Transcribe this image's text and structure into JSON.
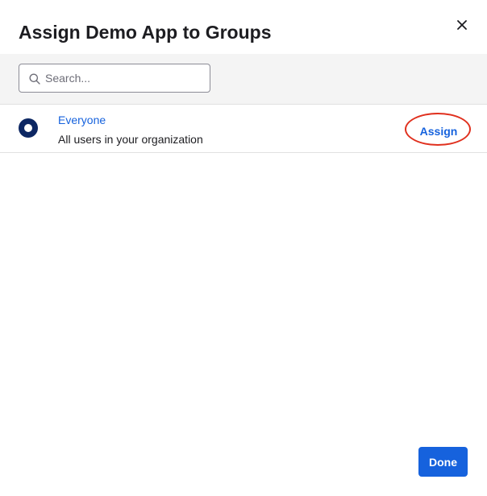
{
  "dialog": {
    "title": "Assign Demo App to Groups",
    "close_icon": "close-icon"
  },
  "search": {
    "placeholder": "Search...",
    "value": "",
    "icon": "search-icon"
  },
  "groups": [
    {
      "name": "Everyone",
      "description": "All users in your organization",
      "icon": "group-circle-icon",
      "action_label": "Assign"
    }
  ],
  "footer": {
    "done_label": "Done"
  },
  "colors": {
    "accent": "#1662dd",
    "group_icon": "#0d2763",
    "highlight": "#e0301e",
    "search_bar_bg": "#f4f4f4"
  }
}
